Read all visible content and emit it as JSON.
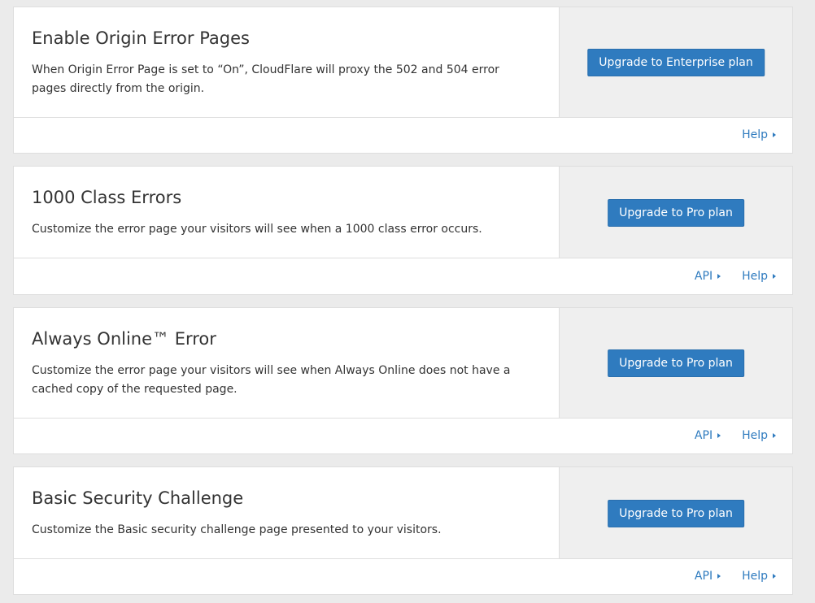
{
  "cards": [
    {
      "title": "Enable Origin Error Pages",
      "description": "When Origin Error Page is set to “On”, CloudFlare will proxy the 502 and 504 error pages directly from the origin.",
      "button_label": "Upgrade to Enterprise plan",
      "links": {
        "help": "Help"
      }
    },
    {
      "title": "1000 Class Errors",
      "description": "Customize the error page your visitors will see when a 1000 class error occurs.",
      "button_label": "Upgrade to Pro plan",
      "links": {
        "api": "API",
        "help": "Help"
      }
    },
    {
      "title": "Always Online™ Error",
      "description": "Customize the error page your visitors will see when Always Online does not have a cached copy of the requested page.",
      "button_label": "Upgrade to Pro plan",
      "links": {
        "api": "API",
        "help": "Help"
      }
    },
    {
      "title": "Basic Security Challenge",
      "description": "Customize the Basic security challenge page presented to your visitors.",
      "button_label": "Upgrade to Pro plan",
      "links": {
        "api": "API",
        "help": "Help"
      }
    }
  ],
  "colors": {
    "accent": "#2f7bbf",
    "page_background": "#ebebeb",
    "side_panel": "#efefef",
    "border": "#dedede"
  },
  "icons": {
    "link_caret": "caret-right-icon"
  }
}
